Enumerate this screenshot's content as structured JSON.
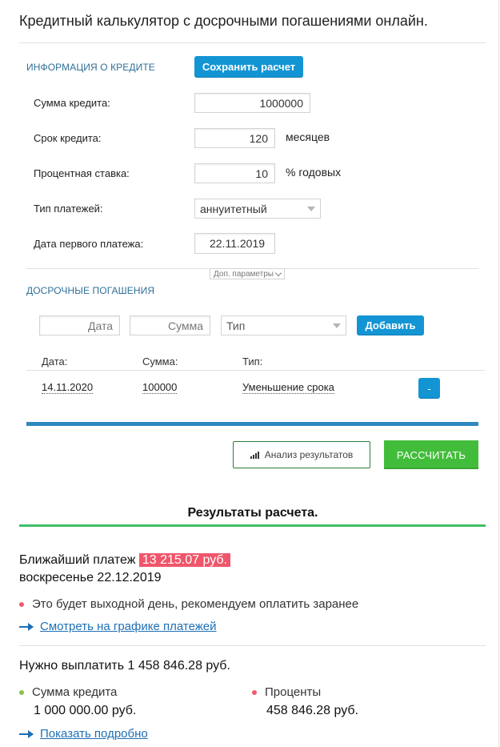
{
  "page": {
    "title": "Кредитный калькулятор с досрочными погашениями онлайн."
  },
  "loan_info": {
    "section_title": "ИНФОРМАЦИЯ О КРЕДИТЕ",
    "save_label": "Сохранить расчет",
    "amount": {
      "label": "Сумма кредита:",
      "value": "1000000"
    },
    "term": {
      "label": "Срок кредита:",
      "value": "120",
      "unit": "месяцев"
    },
    "rate": {
      "label": "Процентная ставка:",
      "value": "10",
      "unit": "% годовых"
    },
    "payment_type": {
      "label": "Тип платежей:",
      "value": "аннуитетный"
    },
    "first_date": {
      "label": "Дата первого платежа:",
      "value": "22.11.2019"
    },
    "extra_params_label": "Доп. параметры"
  },
  "prepay": {
    "section_title": "ДОСРОЧНЫЕ ПОГАШЕНИЯ",
    "date_placeholder": "Дата",
    "sum_placeholder": "Сумма",
    "type_placeholder": "Тип",
    "add_label": "Добавить",
    "columns": [
      "Дата:",
      "Сумма:",
      "Тип:"
    ],
    "rows": [
      {
        "date": "14.11.2020",
        "sum": "100000",
        "type": "Уменьшение срока",
        "remove_label": "-"
      }
    ]
  },
  "actions": {
    "analysis_label": "Анализ результатов",
    "calculate_label": "РАССЧИТАТЬ"
  },
  "results": {
    "title": "Результаты расчета.",
    "next_payment_label": "Ближайший платеж",
    "next_payment_amount": "13 215.07 руб.",
    "next_payment_date": "воскресенье 22.12.2019",
    "weekend_note": "Это будет выходной день, рекомендуем оплатить заранее",
    "schedule_link": "Смотреть на графике платежей",
    "total_text": "Нужно выплатить 1 458 846.28 руб.",
    "principal_label": "Сумма кредита",
    "principal_value": "1 000 000.00 руб.",
    "interest_label": "Проценты",
    "interest_value": "458 846.28 руб.",
    "details_link": "Показать подробно"
  },
  "colors": {
    "accent_blue": "#1395d4",
    "calc_green": "#42bd3b",
    "highlight_red": "#f0566b",
    "principal_dot": "#8bc34a",
    "interest_dot": "#f05a6a",
    "note_dot": "#f05a6a"
  }
}
